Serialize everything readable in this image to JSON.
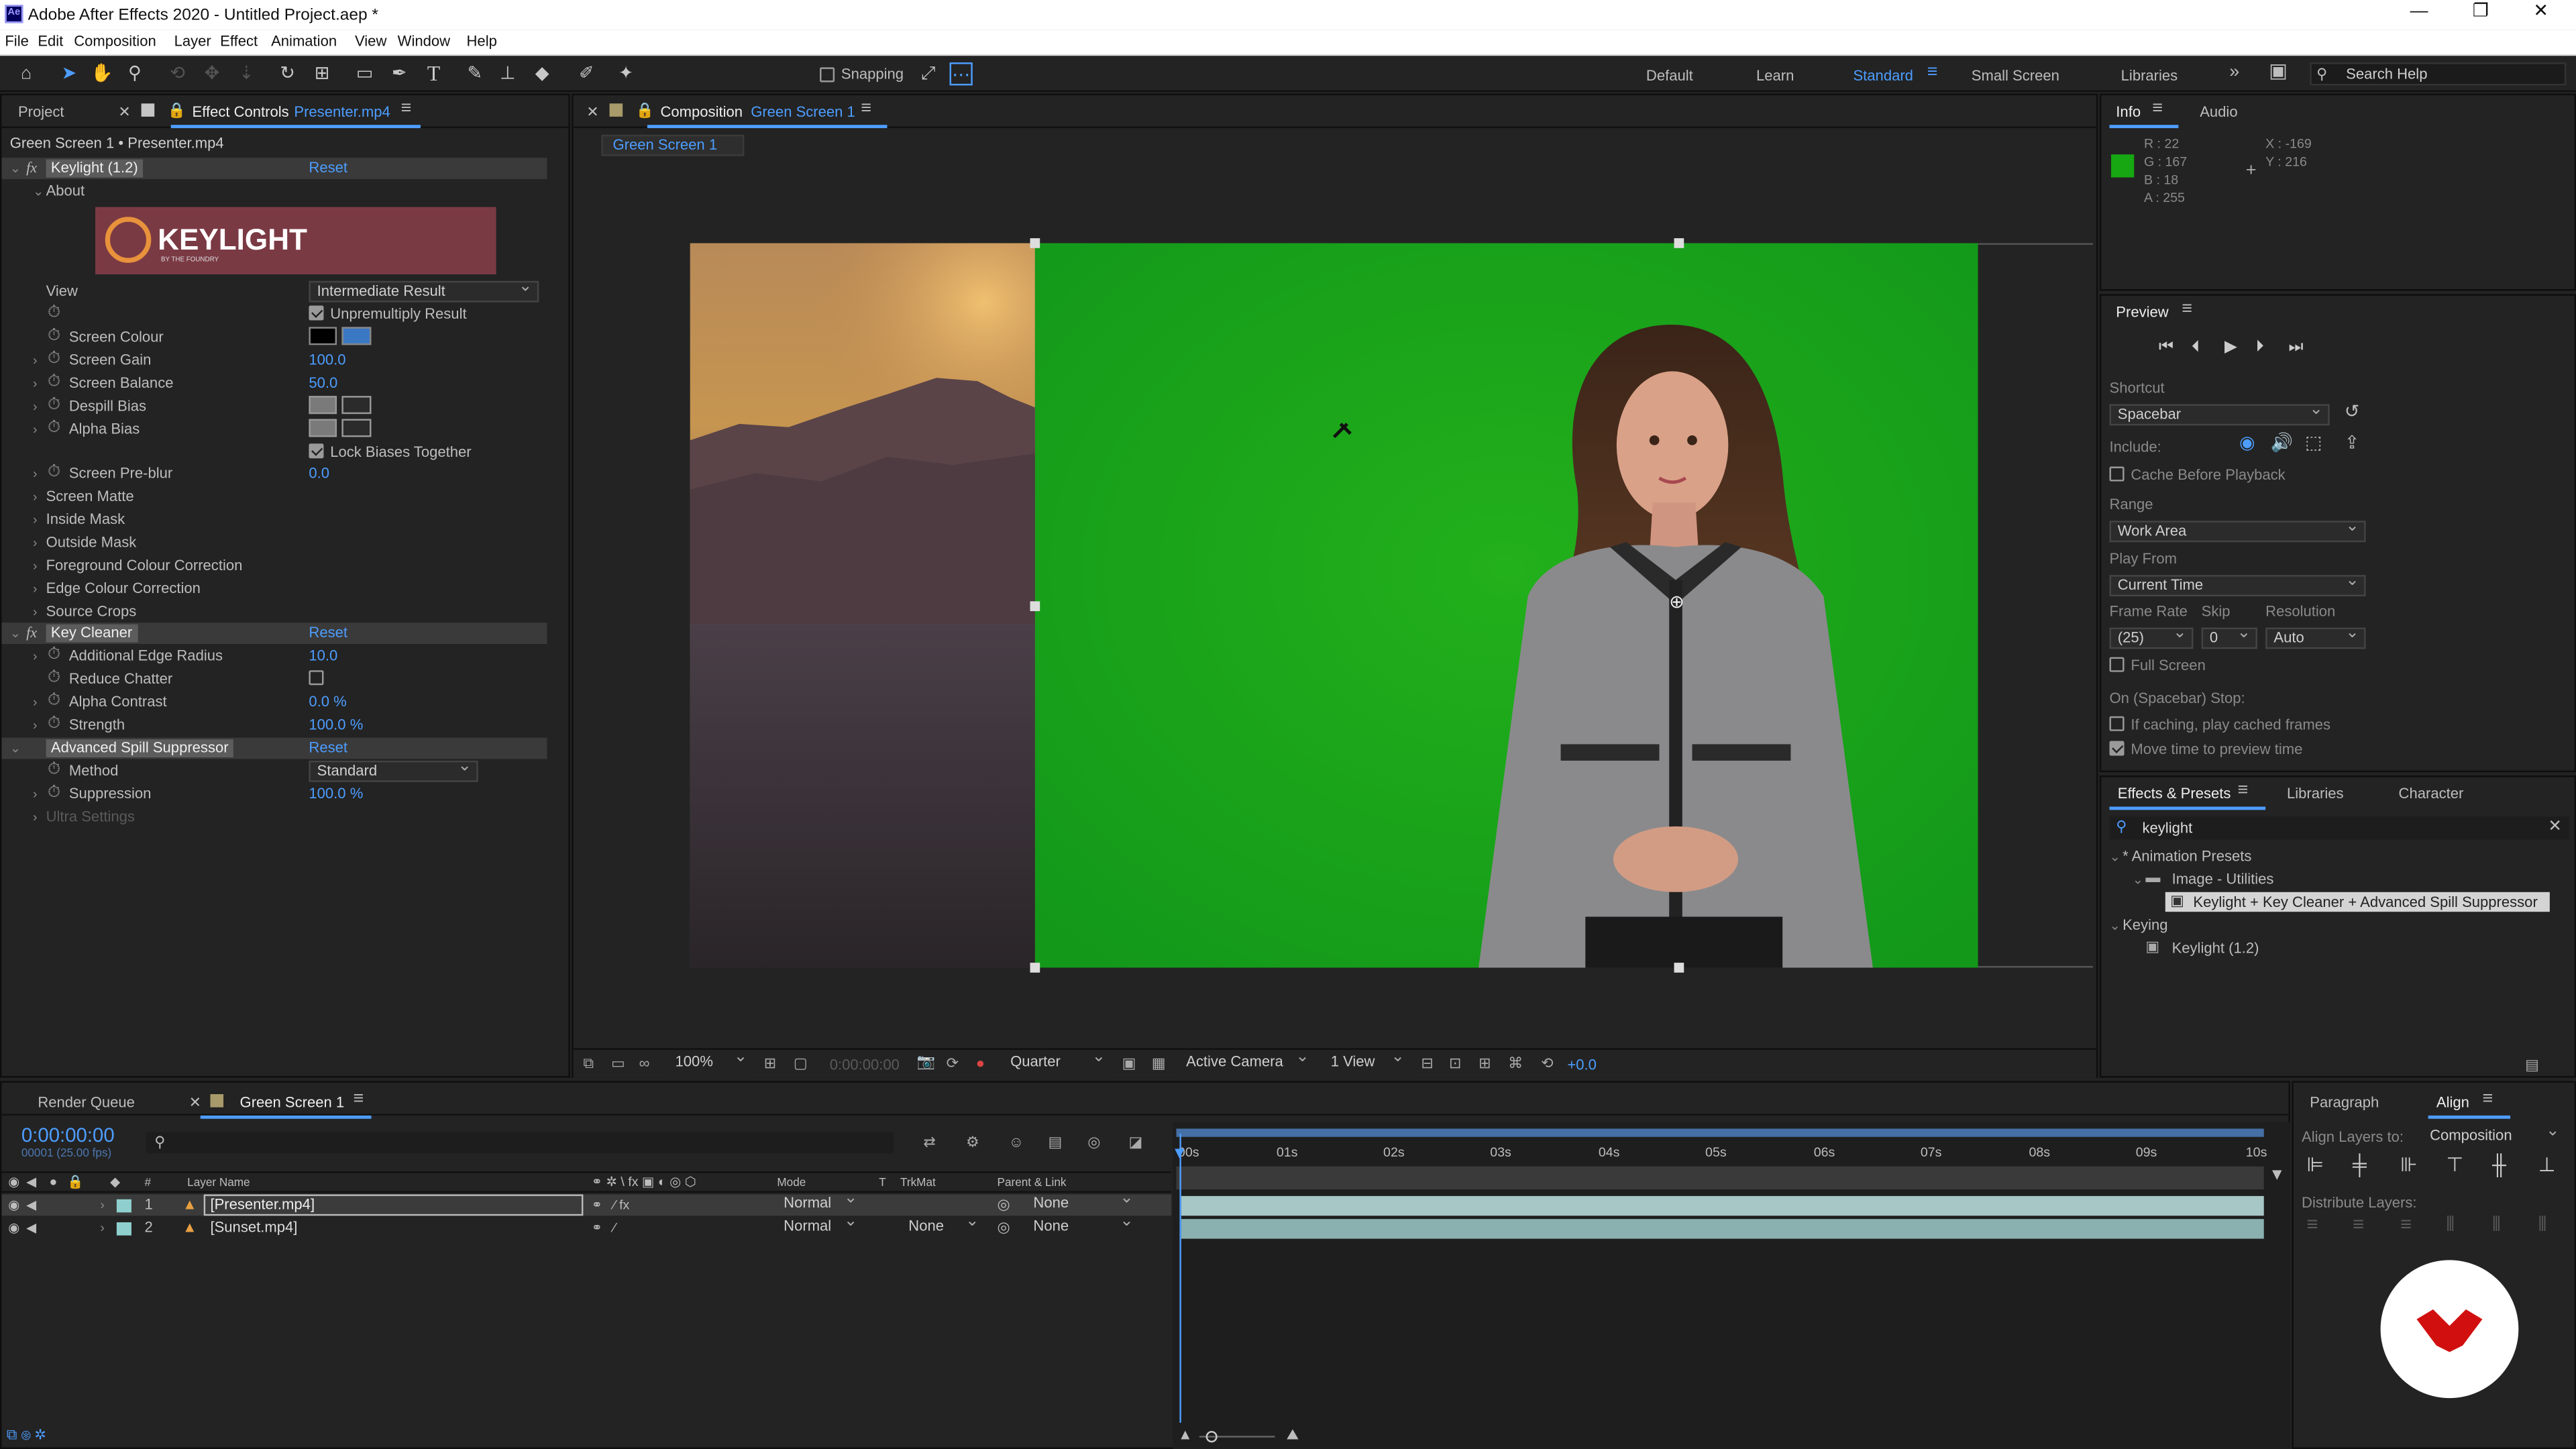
{
  "app": {
    "title": "Adobe After Effects 2020 - Untitled Project.aep *",
    "logo": "Ae"
  },
  "window_controls": {
    "minimize": "—",
    "maximize": "❐",
    "close": "✕"
  },
  "menu": [
    "File",
    "Edit",
    "Composition",
    "Layer",
    "Effect",
    "Animation",
    "View",
    "Window",
    "Help"
  ],
  "toolbar": {
    "snapping": "Snapping",
    "workspaces": [
      "Default",
      "Learn",
      "Standard",
      "Small Screen",
      "Libraries"
    ],
    "active_workspace": "Standard",
    "search_placeholder": "Search Help"
  },
  "left_panel": {
    "tab_project": "Project",
    "tab_effect_controls": "Effect Controls",
    "effect_controls_layer": "Presenter.mp4",
    "breadcrumb": "Green Screen 1 • Presenter.mp4",
    "keylight": {
      "name": "Keylight (1.2)",
      "reset": "Reset",
      "about": "About",
      "banner": "KEYLIGHT",
      "banner_sub": "BY THE FOUNDRY",
      "view_label": "View",
      "view_value": "Intermediate Result",
      "unpremultiply": "Unpremultiply Result",
      "screen_colour": "Screen Colour",
      "screen_gain": "Screen Gain",
      "screen_gain_value": "100.0",
      "screen_balance": "Screen Balance",
      "screen_balance_value": "50.0",
      "despill_bias": "Despill Bias",
      "alpha_bias": "Alpha Bias",
      "lock_biases": "Lock Biases Together",
      "screen_preblur": "Screen Pre-blur",
      "screen_preblur_value": "0.0",
      "groups": [
        "Screen Matte",
        "Inside Mask",
        "Outside Mask",
        "Foreground Colour Correction",
        "Edge Colour Correction",
        "Source Crops"
      ]
    },
    "key_cleaner": {
      "name": "Key Cleaner",
      "reset": "Reset",
      "additional_edge_radius": "Additional Edge Radius",
      "additional_edge_radius_value": "10.0",
      "reduce_chatter": "Reduce Chatter",
      "alpha_contrast": "Alpha Contrast",
      "alpha_contrast_value": "0.0 %",
      "strength": "Strength",
      "strength_value": "100.0 %"
    },
    "spill": {
      "name": "Advanced Spill Suppressor",
      "reset": "Reset",
      "method": "Method",
      "method_value": "Standard",
      "suppression": "Suppression",
      "suppression_value": "100.0 %",
      "ultra": "Ultra Settings"
    }
  },
  "comp_panel": {
    "tab_label": "Composition",
    "comp_name": "Green Screen 1",
    "subtab": "Green Screen 1",
    "bottom": {
      "zoom": "100%",
      "timecode": "0:00:00:00",
      "resolution": "Quarter",
      "camera": "Active Camera",
      "views": "1 View",
      "exposure": "+0.0"
    }
  },
  "info_panel": {
    "tab_info": "Info",
    "tab_audio": "Audio",
    "swatch_color": "#16a712",
    "r": "R :  22",
    "g": "G :  167",
    "b": "B :  18",
    "a": "A :  255",
    "x": "X : -169",
    "y": "Y :  216"
  },
  "preview_panel": {
    "title": "Preview",
    "shortcut_label": "Shortcut",
    "shortcut_value": "Spacebar",
    "include_label": "Include:",
    "cache_before": "Cache Before Playback",
    "range_label": "Range",
    "range_value": "Work Area",
    "play_from_label": "Play From",
    "play_from_value": "Current Time",
    "frame_rate_label": "Frame Rate",
    "frame_rate_value": "(25)",
    "skip_label": "Skip",
    "skip_value": "0",
    "resolution_label": "Resolution",
    "resolution_value": "Auto",
    "full_screen": "Full Screen",
    "stop_label": "On (Spacebar) Stop:",
    "if_caching": "If caching, play cached frames",
    "move_time": "Move time to preview time"
  },
  "effects_panel": {
    "tab_effects": "Effects & Presets",
    "tab_libraries": "Libraries",
    "tab_character": "Character",
    "search_value": "keylight",
    "tree": {
      "animation_presets": "* Animation Presets",
      "image_utilities": "Image - Utilities",
      "preset_item": "Keylight + Key Cleaner + Advanced Spill Suppressor",
      "keying": "Keying",
      "keylight": "Keylight (1.2)"
    }
  },
  "timeline": {
    "tab_render": "Render Queue",
    "tab_comp": "Green Screen 1",
    "timecode": "0:00:00:00",
    "fps": "00001 (25.00 fps)",
    "col_headers": {
      "num": "#",
      "layer_name": "Layer Name",
      "mode": "Mode",
      "t": "T",
      "trkmat": "TrkMat",
      "parent": "Parent & Link"
    },
    "layers": [
      {
        "num": "1",
        "name": "[Presenter.mp4]",
        "mode": "Normal",
        "trkmat": "",
        "parent": "None"
      },
      {
        "num": "2",
        "name": "[Sunset.mp4]",
        "mode": "Normal",
        "trkmat": "None",
        "parent": "None"
      }
    ],
    "ruler": [
      "00s",
      "01s",
      "02s",
      "03s",
      "04s",
      "05s",
      "06s",
      "07s",
      "08s",
      "09s",
      "10s"
    ]
  },
  "align_panel": {
    "tab_paragraph": "Paragraph",
    "tab_align": "Align",
    "align_layers_to": "Align Layers to:",
    "align_to_value": "Composition",
    "distribute": "Distribute Layers:"
  }
}
